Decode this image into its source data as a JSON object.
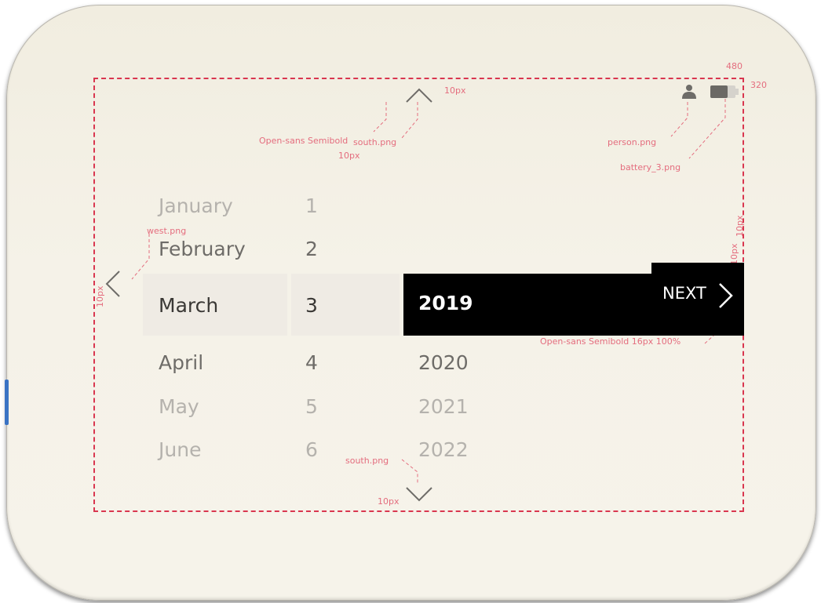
{
  "frame": {
    "width_label": "480",
    "height_label": "320"
  },
  "annotations": {
    "top_arrow_font": "Open-sans Semibold",
    "top_arrow_file": "south.png",
    "top_arrow_gap": "10px",
    "top_arrow_gap2": "10px",
    "person": "person.png",
    "battery": "battery_3.png",
    "west": "west.png",
    "west_gap": "10px",
    "right_gap_a": "10px",
    "right_gap_b": "10px",
    "next_font": "Open-sans Semibold 16px 100%",
    "bottom_arrow_file": "south.png",
    "bottom_arrow_gap": "10px"
  },
  "picker": {
    "months": [
      "January",
      "February",
      "March",
      "April",
      "May",
      "June"
    ],
    "days": [
      "1",
      "2",
      "3",
      "4",
      "5",
      "6"
    ],
    "years": [
      "2019",
      "2020",
      "2021",
      "2022"
    ],
    "selected": {
      "month": "March",
      "day": "3",
      "year": "2019"
    }
  },
  "next_button": {
    "label": "NEXT"
  },
  "icons": {
    "up": "chevron-up-icon",
    "down": "chevron-down-icon",
    "left": "chevron-left-icon",
    "next": "chevron-right-icon",
    "person": "person-icon",
    "battery": "battery-icon"
  },
  "colors": {
    "annotation": "#d9364f",
    "selected_year_bg": "#000000",
    "highlight_row": "#efebe4",
    "device_bg": "#f3f0e6"
  }
}
